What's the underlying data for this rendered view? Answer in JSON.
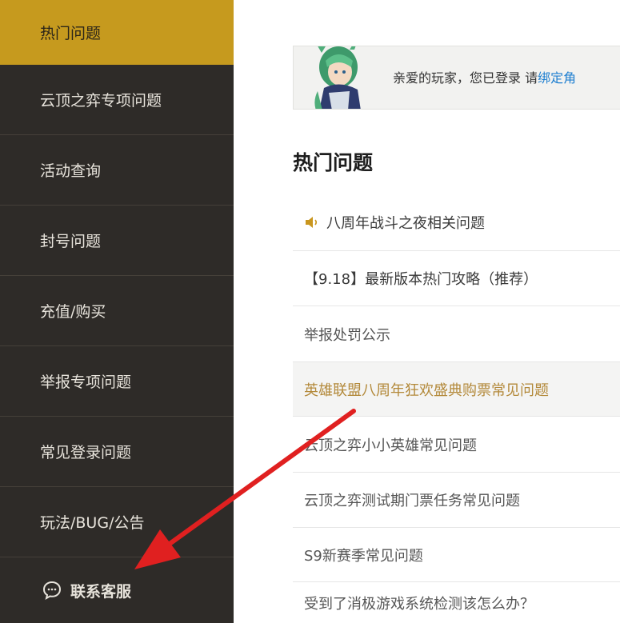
{
  "sidebar": {
    "items": [
      {
        "label": "热门问题"
      },
      {
        "label": "云顶之弈专项问题"
      },
      {
        "label": "活动查询"
      },
      {
        "label": "封号问题"
      },
      {
        "label": "充值/购买"
      },
      {
        "label": "举报专项问题"
      },
      {
        "label": "常见登录问题"
      },
      {
        "label": "玩法/BUG/公告"
      }
    ],
    "contact": {
      "label": "联系客服",
      "icon": "chat-icon"
    },
    "active_color": "#c69a1e",
    "background": "#2e2b28"
  },
  "banner": {
    "text": "亲爱的玩家，您已登录 请",
    "link_text": "绑定角"
  },
  "main": {
    "title": "热门问题",
    "questions": [
      {
        "text": "八周年战斗之夜相关问题",
        "icon": "speaker-icon"
      },
      {
        "text": "【9.18】最新版本热门攻略（推荐）"
      },
      {
        "text": "举报处罚公示"
      },
      {
        "text": "英雄联盟八周年狂欢盛典购票常见问题"
      },
      {
        "text": "云顶之弈小小英雄常见问题"
      },
      {
        "text": "云顶之弈测试期门票任务常见问题"
      },
      {
        "text": "S9新赛季常见问题"
      },
      {
        "text": "受到了消极游戏系统检测该怎么办？"
      }
    ],
    "highlight_color": "#b3893a"
  },
  "annotation": {
    "arrow_color": "#e02020"
  }
}
